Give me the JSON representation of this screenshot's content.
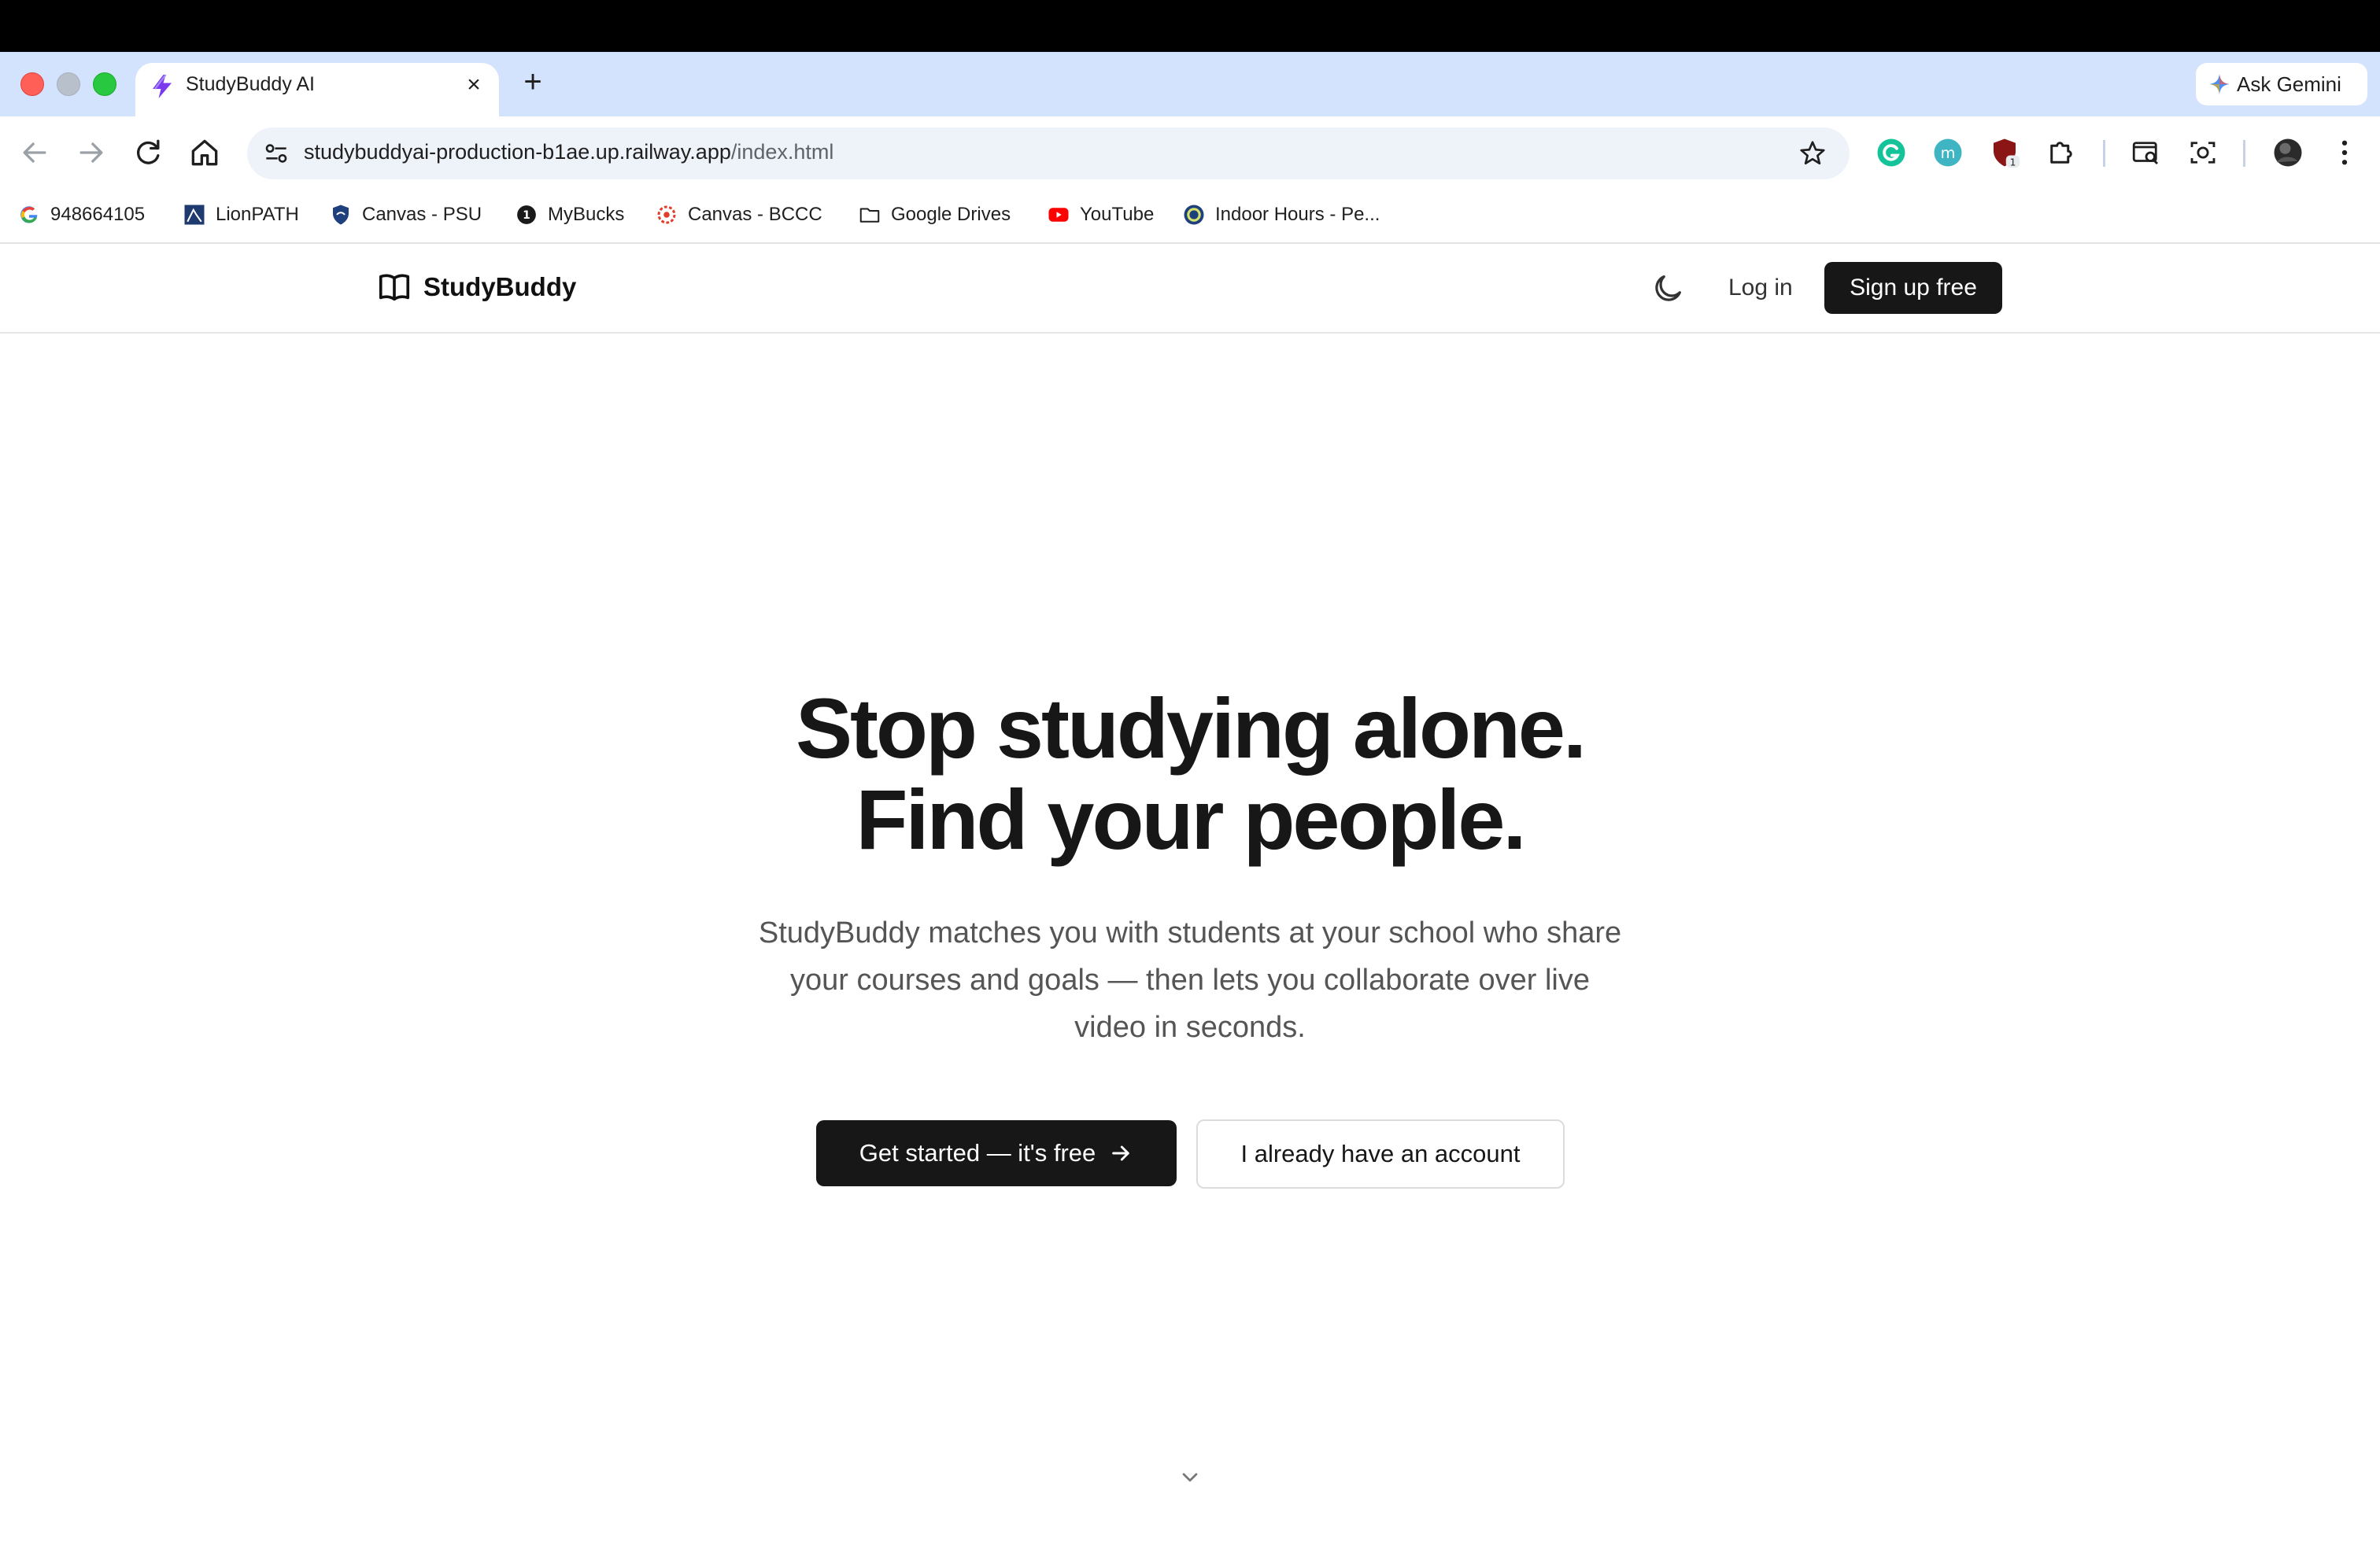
{
  "browser": {
    "tab": {
      "title": "StudyBuddy AI",
      "favicon": "lightning-bolt-icon"
    },
    "new_tab_symbol": "+",
    "close_symbol": "×",
    "ask_gemini_label": "Ask Gemini",
    "url": {
      "host": "studybuddyai-production-b1ae.up.railway.app",
      "path": "/index.html"
    },
    "extension_badge": "1",
    "bookmarks": [
      {
        "label": "948664105",
        "icon": "google-icon"
      },
      {
        "label": "LionPATH",
        "icon": "lionpath-icon"
      },
      {
        "label": "Canvas - PSU",
        "icon": "psu-shield-icon"
      },
      {
        "label": "MyBucks",
        "icon": "mybucks-icon"
      },
      {
        "label": "Canvas - BCCC",
        "icon": "canvas-icon"
      },
      {
        "label": "Google Drives",
        "icon": "folder-icon"
      },
      {
        "label": "YouTube",
        "icon": "youtube-icon"
      },
      {
        "label": "Indoor Hours - Pe...",
        "icon": "psu-logo-icon"
      }
    ]
  },
  "site": {
    "brand": "StudyBuddy",
    "nav": {
      "login": "Log in",
      "signup": "Sign up free"
    }
  },
  "hero": {
    "title_line1": "Stop studying alone.",
    "title_line2": "Find your people.",
    "subtitle": "StudyBuddy matches you with students at your school who share your courses and goals — then lets you collaborate over live video in seconds.",
    "primary_cta": "Get started — it's free",
    "secondary_cta": "I already have an account"
  },
  "colors": {
    "tabstrip": "#d3e3fd",
    "primary_button": "#171717",
    "accent_tab_icon": "#7c3aed"
  }
}
